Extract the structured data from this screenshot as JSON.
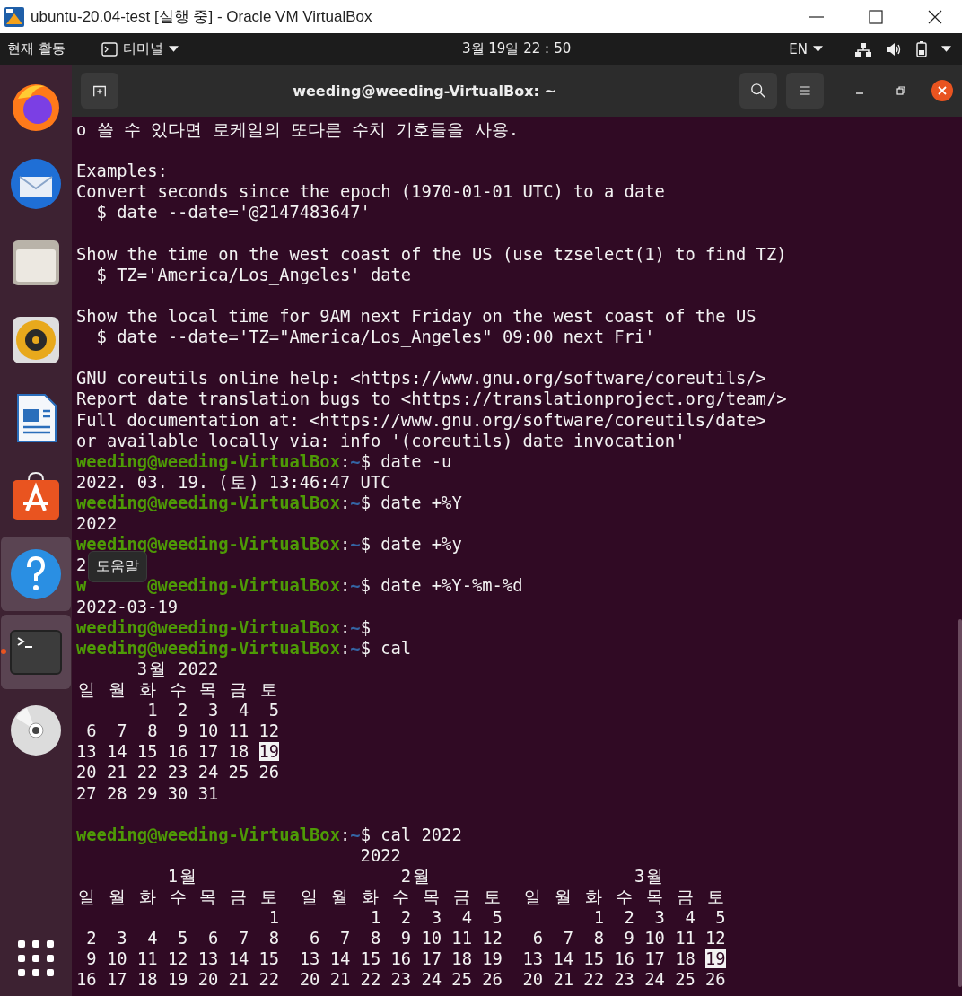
{
  "vbox_window": {
    "title": "ubuntu-20.04-test [실행 중] - Oracle VM VirtualBox"
  },
  "top_bar": {
    "activities": "현재 활동",
    "app_menu": "터미널",
    "clock": "3월 19일  22：50",
    "input_source": "EN"
  },
  "dock": {
    "items": [
      {
        "highlighted": false,
        "running": false
      },
      {
        "highlighted": false,
        "running": false
      },
      {
        "highlighted": false,
        "running": false
      },
      {
        "highlighted": false,
        "running": false
      },
      {
        "highlighted": false,
        "running": false
      },
      {
        "highlighted": false,
        "running": false
      },
      {
        "highlighted": true,
        "running": false
      },
      {
        "highlighted": true,
        "running": true
      },
      {
        "highlighted": false,
        "running": false
      }
    ],
    "tooltip": "도움말"
  },
  "terminal": {
    "title": "weeding@weeding-VirtualBox: ~",
    "lines": [
      {
        "kind": "text",
        "segs": [
          {
            "kind": "plain",
            "text": "o 쓸 수 있다면 로케일의 또다른 수치 기호들을 사용."
          }
        ]
      },
      {
        "kind": "blank"
      },
      {
        "kind": "text",
        "segs": [
          {
            "kind": "plain",
            "text": "Examples:"
          }
        ]
      },
      {
        "kind": "text",
        "segs": [
          {
            "kind": "plain",
            "text": "Convert seconds since the epoch (1970-01-01 UTC) to a date"
          }
        ]
      },
      {
        "kind": "text",
        "segs": [
          {
            "kind": "plain",
            "text": "  $ date --date='@2147483647'"
          }
        ]
      },
      {
        "kind": "blank"
      },
      {
        "kind": "text",
        "segs": [
          {
            "kind": "plain",
            "text": "Show the time on the west coast of the US (use tzselect(1) to find TZ)"
          }
        ]
      },
      {
        "kind": "text",
        "segs": [
          {
            "kind": "plain",
            "text": "  $ TZ='America/Los_Angeles' date"
          }
        ]
      },
      {
        "kind": "blank"
      },
      {
        "kind": "text",
        "segs": [
          {
            "kind": "plain",
            "text": "Show the local time for 9AM next Friday on the west coast of the US"
          }
        ]
      },
      {
        "kind": "text",
        "segs": [
          {
            "kind": "plain",
            "text": "  $ date --date='TZ=\"America/Los_Angeles\" 09:00 next Fri'"
          }
        ]
      },
      {
        "kind": "blank"
      },
      {
        "kind": "text",
        "segs": [
          {
            "kind": "plain",
            "text": "GNU coreutils online help: <https://www.gnu.org/software/coreutils/>"
          }
        ]
      },
      {
        "kind": "text",
        "segs": [
          {
            "kind": "plain",
            "text": "Report date translation bugs to <https://translationproject.org/team/>"
          }
        ]
      },
      {
        "kind": "text",
        "segs": [
          {
            "kind": "plain",
            "text": "Full documentation at: <https://www.gnu.org/software/coreutils/date>"
          }
        ]
      },
      {
        "kind": "text",
        "segs": [
          {
            "kind": "plain",
            "text": "or available locally via: info '(coreutils) date invocation'"
          }
        ]
      },
      {
        "kind": "text",
        "segs": [
          {
            "kind": "user",
            "text": "weeding@weeding-VirtualBox"
          },
          {
            "kind": "plain",
            "text": ":"
          },
          {
            "kind": "path",
            "text": "~"
          },
          {
            "kind": "plain",
            "text": "$ date -u"
          }
        ]
      },
      {
        "kind": "text",
        "segs": [
          {
            "kind": "plain",
            "text": "2022. 03. 19. ("
          },
          {
            "kind": "wide",
            "text": "토"
          },
          {
            "kind": "plain",
            "text": ") 13:46:47 UTC"
          }
        ]
      },
      {
        "kind": "text",
        "segs": [
          {
            "kind": "user",
            "text": "weeding@weeding-VirtualBox"
          },
          {
            "kind": "plain",
            "text": ":"
          },
          {
            "kind": "path",
            "text": "~"
          },
          {
            "kind": "plain",
            "text": "$ date +%Y"
          }
        ]
      },
      {
        "kind": "text",
        "segs": [
          {
            "kind": "plain",
            "text": "2022"
          }
        ]
      },
      {
        "kind": "text",
        "segs": [
          {
            "kind": "user",
            "text": "weeding@weeding-VirtualBox"
          },
          {
            "kind": "plain",
            "text": ":"
          },
          {
            "kind": "path",
            "text": "~"
          },
          {
            "kind": "plain",
            "text": "$ date +%y"
          }
        ]
      },
      {
        "kind": "text",
        "segs": [
          {
            "kind": "plain",
            "text": "2"
          }
        ]
      },
      {
        "kind": "text",
        "segs": [
          {
            "kind": "user",
            "text": "w"
          },
          {
            "kind": "user_resumed",
            "text": "@weeding-VirtualBox"
          },
          {
            "kind": "plain",
            "text": ":"
          },
          {
            "kind": "path",
            "text": "~"
          },
          {
            "kind": "plain",
            "text": "$ date +%Y-%m-%d"
          }
        ]
      },
      {
        "kind": "text",
        "segs": [
          {
            "kind": "plain",
            "text": "2022-03-19"
          }
        ]
      },
      {
        "kind": "text",
        "segs": [
          {
            "kind": "user",
            "text": "weeding@weeding-VirtualBox"
          },
          {
            "kind": "plain",
            "text": ":"
          },
          {
            "kind": "path",
            "text": "~"
          },
          {
            "kind": "plain",
            "text": "$"
          }
        ]
      },
      {
        "kind": "text",
        "segs": [
          {
            "kind": "user",
            "text": "weeding@weeding-VirtualBox"
          },
          {
            "kind": "plain",
            "text": ":"
          },
          {
            "kind": "path",
            "text": "~"
          },
          {
            "kind": "plain",
            "text": "$ cal"
          }
        ]
      },
      {
        "kind": "text",
        "segs": [
          {
            "kind": "plain",
            "text": "      3"
          },
          {
            "kind": "wide",
            "text": "월"
          },
          {
            "kind": "plain",
            "text": " 2022"
          }
        ]
      },
      {
        "kind": "weekdays",
        "groups": [
          [
            "일",
            "월",
            "화",
            "수",
            "목",
            "금",
            "토"
          ]
        ]
      },
      {
        "kind": "text",
        "segs": [
          {
            "kind": "plain",
            "text": "       1  2  3  4  5"
          }
        ]
      },
      {
        "kind": "text",
        "segs": [
          {
            "kind": "plain",
            "text": " 6  7  8  9 10 11 12"
          }
        ]
      },
      {
        "kind": "text",
        "segs": [
          {
            "kind": "plain",
            "text": "13 14 15 16 17 18 "
          },
          {
            "kind": "today",
            "text": "19"
          }
        ]
      },
      {
        "kind": "text",
        "segs": [
          {
            "kind": "plain",
            "text": "20 21 22 23 24 25 26"
          }
        ]
      },
      {
        "kind": "text",
        "segs": [
          {
            "kind": "plain",
            "text": "27 28 29 30 31"
          }
        ]
      },
      {
        "kind": "blank"
      },
      {
        "kind": "text",
        "segs": [
          {
            "kind": "user",
            "text": "weeding@weeding-VirtualBox"
          },
          {
            "kind": "plain",
            "text": ":"
          },
          {
            "kind": "path",
            "text": "~"
          },
          {
            "kind": "plain",
            "text": "$ cal 2022"
          }
        ]
      },
      {
        "kind": "text",
        "segs": [
          {
            "kind": "plain",
            "text": "                            2022"
          }
        ]
      },
      {
        "kind": "text",
        "segs": [
          {
            "kind": "plain",
            "text": "         1"
          },
          {
            "kind": "wide",
            "text": "월"
          },
          {
            "kind": "plain",
            "text": "                    2"
          },
          {
            "kind": "wide",
            "text": "월"
          },
          {
            "kind": "plain",
            "text": "                    3"
          },
          {
            "kind": "wide",
            "text": "월"
          }
        ]
      },
      {
        "kind": "weekdays",
        "groups": [
          [
            "일",
            "월",
            "화",
            "수",
            "목",
            "금",
            "토"
          ],
          [
            "일",
            "월",
            "화",
            "수",
            "목",
            "금",
            "토"
          ],
          [
            "일",
            "월",
            "화",
            "수",
            "목",
            "금",
            "토"
          ]
        ]
      },
      {
        "kind": "text",
        "segs": [
          {
            "kind": "plain",
            "text": "                   1         1  2  3  4  5         1  2  3  4  5"
          }
        ]
      },
      {
        "kind": "text",
        "segs": [
          {
            "kind": "plain",
            "text": " 2  3  4  5  6  7  8   6  7  8  9 10 11 12   6  7  8  9 10 11 12"
          }
        ]
      },
      {
        "kind": "text",
        "segs": [
          {
            "kind": "plain",
            "text": " 9 10 11 12 13 14 15  13 14 15 16 17 18 19  13 14 15 16 17 18 "
          },
          {
            "kind": "today",
            "text": "19"
          }
        ]
      },
      {
        "kind": "text",
        "segs": [
          {
            "kind": "plain",
            "text": "16 17 18 19 20 21 22  20 21 22 23 24 25 26  20 21 22 23 24 25 26"
          }
        ]
      }
    ]
  }
}
